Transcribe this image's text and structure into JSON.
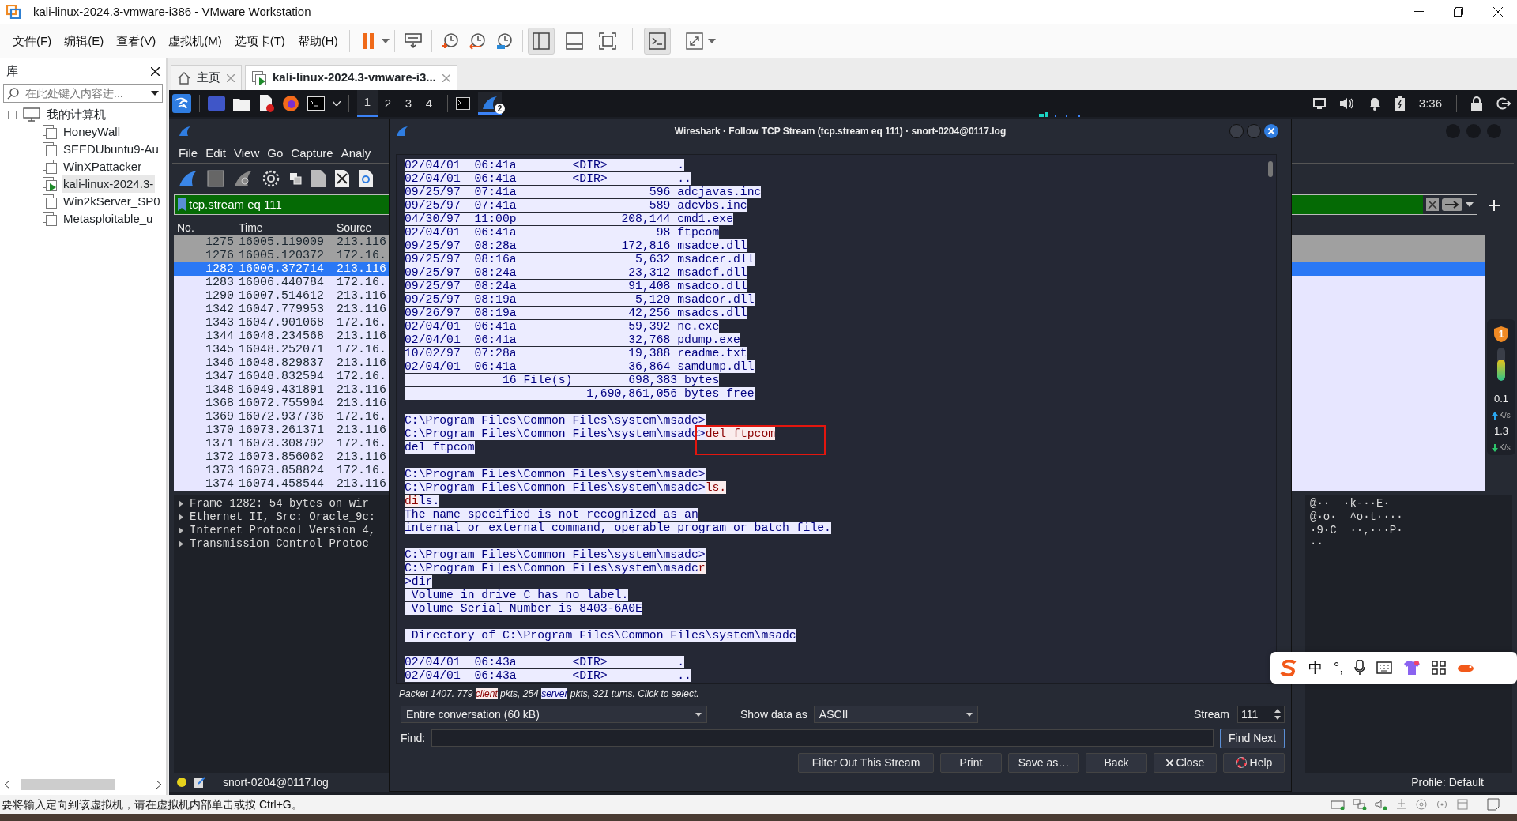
{
  "window": {
    "title": "kali-linux-2024.3-vmware-i386 - VMware Workstation"
  },
  "menu": [
    "文件(F)",
    "编辑(E)",
    "查看(V)",
    "虚拟机(M)",
    "选项卡(T)",
    "帮助(H)"
  ],
  "view_toggles": [
    {
      "selected": true
    },
    {
      "selected": false
    },
    {
      "selected": false
    },
    {
      "selected": true
    }
  ],
  "library": {
    "title": "库",
    "search": {
      "placeholder": "在此处键入内容进..."
    },
    "tree": [
      {
        "label": "我的计算机",
        "expanded": true,
        "children": [
          {
            "label": "HoneyWall",
            "running": false,
            "selected": false
          },
          {
            "label": "SEEDUbuntu9-Au",
            "running": false,
            "selected": false
          },
          {
            "label": "WinXPattacker",
            "running": false,
            "selected": false
          },
          {
            "label": "kali-linux-2024.3-",
            "running": true,
            "selected": true
          },
          {
            "label": "Win2kServer_SP0",
            "running": false,
            "selected": false
          },
          {
            "label": "Metasploitable_u",
            "running": false,
            "selected": false
          }
        ]
      }
    ]
  },
  "tabs": [
    {
      "label": "主页",
      "selected": false
    },
    {
      "label": "kali-linux-2024.3-vmware-i3...",
      "selected": true
    }
  ],
  "guest_panel": {
    "workspaces": [
      {
        "label": "1",
        "selected": true
      },
      {
        "label": "2",
        "selected": false
      },
      {
        "label": "3",
        "selected": false
      },
      {
        "label": "4",
        "selected": false
      }
    ],
    "app_badge": "2",
    "clock": "3:36"
  },
  "wireshark": {
    "menu": [
      "File",
      "Edit",
      "View",
      "Go",
      "Capture",
      "Analy"
    ],
    "filter": "tcp.stream eq 111",
    "columns": [
      "No.",
      "Time",
      "Source"
    ],
    "packets": [
      {
        "no": "1275",
        "time": "16005.119009",
        "source": "213.116",
        "color": "#a0a0a0",
        "selected": false
      },
      {
        "no": "1276",
        "time": "16005.120372",
        "source": "172.16.",
        "color": "#a0a0a0",
        "selected": false
      },
      {
        "no": "1282",
        "time": "16006.372714",
        "source": "213.116",
        "selected": true
      },
      {
        "no": "1283",
        "time": "16006.440784",
        "source": "172.16.",
        "color": "#e7e6ff",
        "selected": false
      },
      {
        "no": "1290",
        "time": "16007.514612",
        "source": "213.116",
        "color": "#e7e6ff",
        "selected": false
      },
      {
        "no": "1342",
        "time": "16047.779953",
        "source": "213.116",
        "color": "#e7e6ff",
        "selected": false
      },
      {
        "no": "1343",
        "time": "16047.901068",
        "source": "172.16.",
        "color": "#e7e6ff",
        "selected": false
      },
      {
        "no": "1344",
        "time": "16048.234568",
        "source": "213.116",
        "color": "#e7e6ff",
        "selected": false
      },
      {
        "no": "1345",
        "time": "16048.252071",
        "source": "172.16.",
        "color": "#e7e6ff",
        "selected": false
      },
      {
        "no": "1346",
        "time": "16048.829837",
        "source": "213.116",
        "color": "#e7e6ff",
        "selected": false
      },
      {
        "no": "1347",
        "time": "16048.832594",
        "source": "172.16.",
        "color": "#e7e6ff",
        "selected": false
      },
      {
        "no": "1348",
        "time": "16049.431891",
        "source": "213.116",
        "color": "#e7e6ff",
        "selected": false
      },
      {
        "no": "1368",
        "time": "16072.755904",
        "source": "213.116",
        "color": "#e7e6ff",
        "selected": false
      },
      {
        "no": "1369",
        "time": "16072.937736",
        "source": "172.16.",
        "color": "#e7e6ff",
        "selected": false
      },
      {
        "no": "1370",
        "time": "16073.261371",
        "source": "213.116",
        "color": "#e7e6ff",
        "selected": false
      },
      {
        "no": "1371",
        "time": "16073.308792",
        "source": "172.16.",
        "color": "#e7e6ff",
        "selected": false
      },
      {
        "no": "1372",
        "time": "16073.856062",
        "source": "213.116",
        "color": "#e7e6ff",
        "selected": false
      },
      {
        "no": "1373",
        "time": "16073.858824",
        "source": "172.16.",
        "color": "#e7e6ff",
        "selected": false
      },
      {
        "no": "1374",
        "time": "16074.458544",
        "source": "213.116",
        "color": "#e7e6ff",
        "selected": false
      }
    ],
    "details": [
      "Frame 1282: 54 bytes on wir",
      "Ethernet II, Src: Oracle_9c:",
      "Internet Protocol Version 4,",
      "Transmission Control Protoc"
    ],
    "bytes": [
      "@··  ·k-··E·",
      "@·o·  ^o·t····",
      "·9·C  ··,···P·",
      "··"
    ],
    "status": {
      "file": "snort-0204@0117.log",
      "profile": "Profile: Default"
    }
  },
  "follow": {
    "title": "Wireshark · Follow TCP Stream (tcp.stream eq 111) · snort-0204@0117.log",
    "blocks": [
      {
        "lines": [
          {
            "segments": [
              {
                "text": "02/04/01  06:41a        <DIR>          .",
                "kind": "server"
              }
            ]
          },
          {
            "segments": [
              {
                "text": "02/04/01  06:41a        <DIR>          ..",
                "kind": "server"
              }
            ]
          },
          {
            "segments": [
              {
                "text": "09/25/97  07:41a                   596 adcjavas.inc",
                "kind": "server"
              }
            ]
          },
          {
            "segments": [
              {
                "text": "09/25/97  07:41a                   589 adcvbs.inc",
                "kind": "server"
              }
            ]
          },
          {
            "segments": [
              {
                "text": "04/30/97  11:00p               208,144 cmd1.exe",
                "kind": "server"
              }
            ]
          },
          {
            "segments": [
              {
                "text": "02/04/01  06:41a                    98 ftpcom",
                "kind": "server"
              }
            ]
          },
          {
            "segments": [
              {
                "text": "09/25/97  08:28a               172,816 msadce.dll",
                "kind": "server"
              }
            ]
          },
          {
            "segments": [
              {
                "text": "09/25/97  08:16a                 5,632 msadcer.dll",
                "kind": "server"
              }
            ]
          },
          {
            "segments": [
              {
                "text": "09/25/97  08:24a                23,312 msadcf.dll",
                "kind": "server"
              }
            ]
          },
          {
            "segments": [
              {
                "text": "09/25/97  08:24a                91,408 msadco.dll",
                "kind": "server"
              }
            ]
          },
          {
            "segments": [
              {
                "text": "09/25/97  08:19a                 5,120 msadcor.dll",
                "kind": "server"
              }
            ]
          },
          {
            "segments": [
              {
                "text": "09/26/97  08:19a                42,256 msadcs.dll",
                "kind": "server"
              }
            ]
          },
          {
            "segments": [
              {
                "text": "02/04/01  06:41a                59,392 nc.exe",
                "kind": "server"
              }
            ]
          },
          {
            "segments": [
              {
                "text": "02/04/01  06:41a                32,768 pdump.exe",
                "kind": "server"
              }
            ]
          },
          {
            "segments": [
              {
                "text": "10/02/97  07:28a                19,388 readme.txt",
                "kind": "server"
              }
            ]
          },
          {
            "segments": [
              {
                "text": "02/04/01  06:41a                36,864 samdump.dll",
                "kind": "server"
              }
            ]
          },
          {
            "segments": [
              {
                "text": "              16 File(s)        698,383 bytes",
                "kind": "server"
              }
            ]
          },
          {
            "segments": [
              {
                "text": "                          1,690,861,056 bytes free",
                "kind": "server"
              }
            ]
          }
        ]
      },
      {
        "lines": [
          {
            "segments": [
              {
                "text": "C:\\Program Files\\Common Files\\system\\msadc>",
                "kind": "server"
              }
            ]
          },
          {
            "segments": [
              {
                "text": "C:\\Program Files\\Common Files\\system\\msadc>",
                "kind": "server"
              },
              {
                "text": "del ftpcom",
                "kind": "client",
                "marked": true
              }
            ]
          },
          {
            "segments": [
              {
                "text": "del ftpcom",
                "kind": "server"
              }
            ]
          }
        ]
      },
      {
        "lines": [
          {
            "segments": [
              {
                "text": "C:\\Program Files\\Common Files\\system\\msadc>",
                "kind": "server"
              }
            ]
          },
          {
            "segments": [
              {
                "text": "C:\\Program Files\\Common Files\\system\\msadc>",
                "kind": "server"
              },
              {
                "text": "ls.",
                "kind": "client"
              }
            ]
          },
          {
            "segments": [
              {
                "text": "di",
                "kind": "client"
              },
              {
                "text": "ls.",
                "kind": "server"
              }
            ]
          },
          {
            "segments": [
              {
                "text": "The name specified is not recognized as an",
                "kind": "server"
              }
            ]
          },
          {
            "segments": [
              {
                "text": "internal or external command, operable program or batch file.",
                "kind": "server"
              }
            ]
          }
        ]
      },
      {
        "lines": [
          {
            "segments": [
              {
                "text": "C:\\Program Files\\Common Files\\system\\msadc>",
                "kind": "server"
              }
            ]
          },
          {
            "segments": [
              {
                "text": "C:\\Program Files\\Common Files\\system\\msadc",
                "kind": "server"
              },
              {
                "text": "r",
                "kind": "client"
              }
            ]
          },
          {
            "segments": [
              {
                "text": ">dir",
                "kind": "server"
              }
            ]
          },
          {
            "segments": [
              {
                "text": " Volume in drive C has no label.",
                "kind": "server"
              }
            ]
          },
          {
            "segments": [
              {
                "text": " Volume Serial Number is 8403-6A0E",
                "kind": "server"
              }
            ]
          }
        ]
      },
      {
        "lines": [
          {
            "segments": [
              {
                "text": " Directory of C:\\Program Files\\Common Files\\system\\msadc",
                "kind": "server"
              }
            ]
          }
        ]
      },
      {
        "lines": [
          {
            "segments": [
              {
                "text": "02/04/01  06:43a        <DIR>          .",
                "kind": "server"
              }
            ]
          },
          {
            "segments": [
              {
                "text": "02/04/01  06:43a        <DIR>          ..",
                "kind": "server"
              }
            ]
          }
        ]
      }
    ],
    "summary": [
      {
        "text": "Packet 1407. 779 ",
        "kind": "plain"
      },
      {
        "text": "client",
        "kind": "client"
      },
      {
        "text": " pkts, 254 ",
        "kind": "plain"
      },
      {
        "text": "server",
        "kind": "server"
      },
      {
        "text": " pkts, 321 turns. Click to select.",
        "kind": "plain"
      }
    ],
    "conversation": "Entire conversation (60 kB)",
    "show_as_label": "Show data as",
    "show_as": "ASCII",
    "stream_label": "Stream",
    "stream": "111",
    "find_label": "Find:",
    "find_button": "Find Next",
    "buttons": [
      {
        "label": "Filter Out This Stream",
        "kind": "plain"
      },
      {
        "label": "Print",
        "kind": "plain"
      },
      {
        "label": "Save as…",
        "kind": "plain"
      },
      {
        "label": "Back",
        "kind": "plain"
      },
      {
        "label": "Close",
        "kind": "close"
      },
      {
        "label": "Help",
        "kind": "help"
      }
    ]
  },
  "net_widget": {
    "badge": "1",
    "level": 0.65,
    "upload": "0.1",
    "upload_unit": "K/s",
    "download": "1.3",
    "download_unit": "K/s"
  },
  "ime_toolbar": {
    "mode": "中",
    "punctuation": "°,"
  },
  "status_bar": {
    "text": "要将输入定向到该虚拟机，请在虚拟机内部单击或按 Ctrl+G。"
  }
}
